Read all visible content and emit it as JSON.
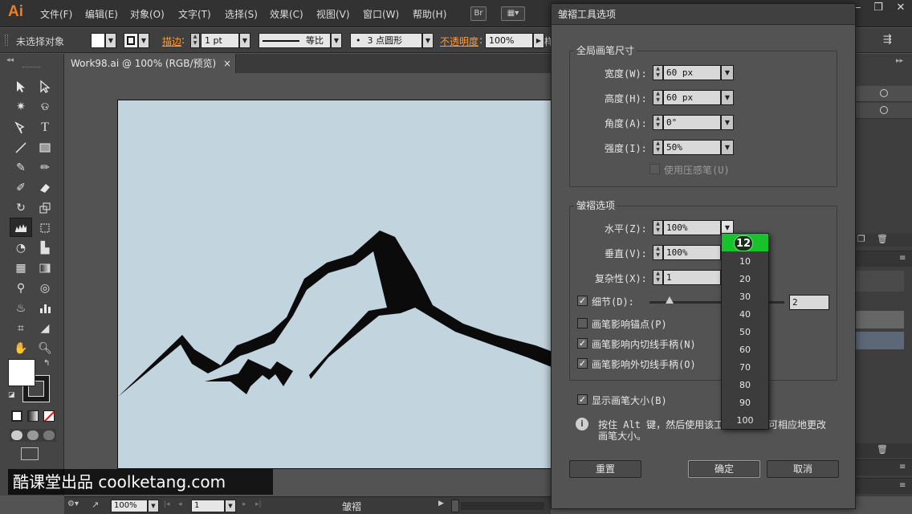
{
  "app": {
    "logo": "Ai"
  },
  "menu": [
    "文件(F)",
    "编辑(E)",
    "对象(O)",
    "文字(T)",
    "选择(S)",
    "效果(C)",
    "视图(V)",
    "窗口(W)",
    "帮助(H)"
  ],
  "menu_extras": {
    "bridge": "Br"
  },
  "controlbar": {
    "selection": "未选择对象",
    "stroke_label": "描边",
    "stroke_value": "1 pt",
    "profile": "等比",
    "brush": "3 点圆形",
    "opacity_label": "不透明度",
    "opacity_value": "100%",
    "trailing_char": "样"
  },
  "document": {
    "tab_title": "Work98.ai @ 100% (RGB/预览)",
    "close": "×"
  },
  "statusbar": {
    "zoom": "100%",
    "artboard": "1",
    "tool": "皱褶"
  },
  "dialog": {
    "title": "皱褶工具选项",
    "global": {
      "title": "全局画笔尺寸",
      "width_label": "宽度(W):",
      "width_value": "60 px",
      "height_label": "高度(H):",
      "height_value": "60 px",
      "angle_label": "角度(A):",
      "angle_value": "0°",
      "intensity_label": "强度(I):",
      "intensity_value": "50%",
      "pressure_label": "使用压感笔(U)"
    },
    "crinkle": {
      "title": "皱褶选项",
      "horizontal_label": "水平(Z):",
      "horizontal_value": "100%",
      "vertical_label": "垂直(V):",
      "vertical_value": "100%",
      "complexity_label": "复杂性(X):",
      "complexity_value": "1",
      "detail_label": "细节(D):",
      "detail_value": "2",
      "detail_slider": 0.15,
      "anchor_label": "画笔影响锚点(P)",
      "in_handle_label": "画笔影响内切线手柄(N)",
      "out_handle_label": "画笔影响外切线手柄(O)"
    },
    "show_size_label": "显示画笔大小(B)",
    "info_line1": "按住 Alt 键，然后使用该工",
    "info_line1_tail": "可相应地更改",
    "info_line2": "画笔大小。",
    "reset": "重置",
    "ok": "确定",
    "cancel": "取消"
  },
  "dropdown": {
    "selected": "12",
    "options": [
      "10",
      "20",
      "30",
      "40",
      "50",
      "60",
      "70",
      "80",
      "90",
      "100"
    ]
  },
  "watermark": "酷课堂出品 coolketang.com",
  "colors": {
    "accent_orange": "#f07d22",
    "selection_green": "#17c22a",
    "artboard": "#c2d4de"
  }
}
